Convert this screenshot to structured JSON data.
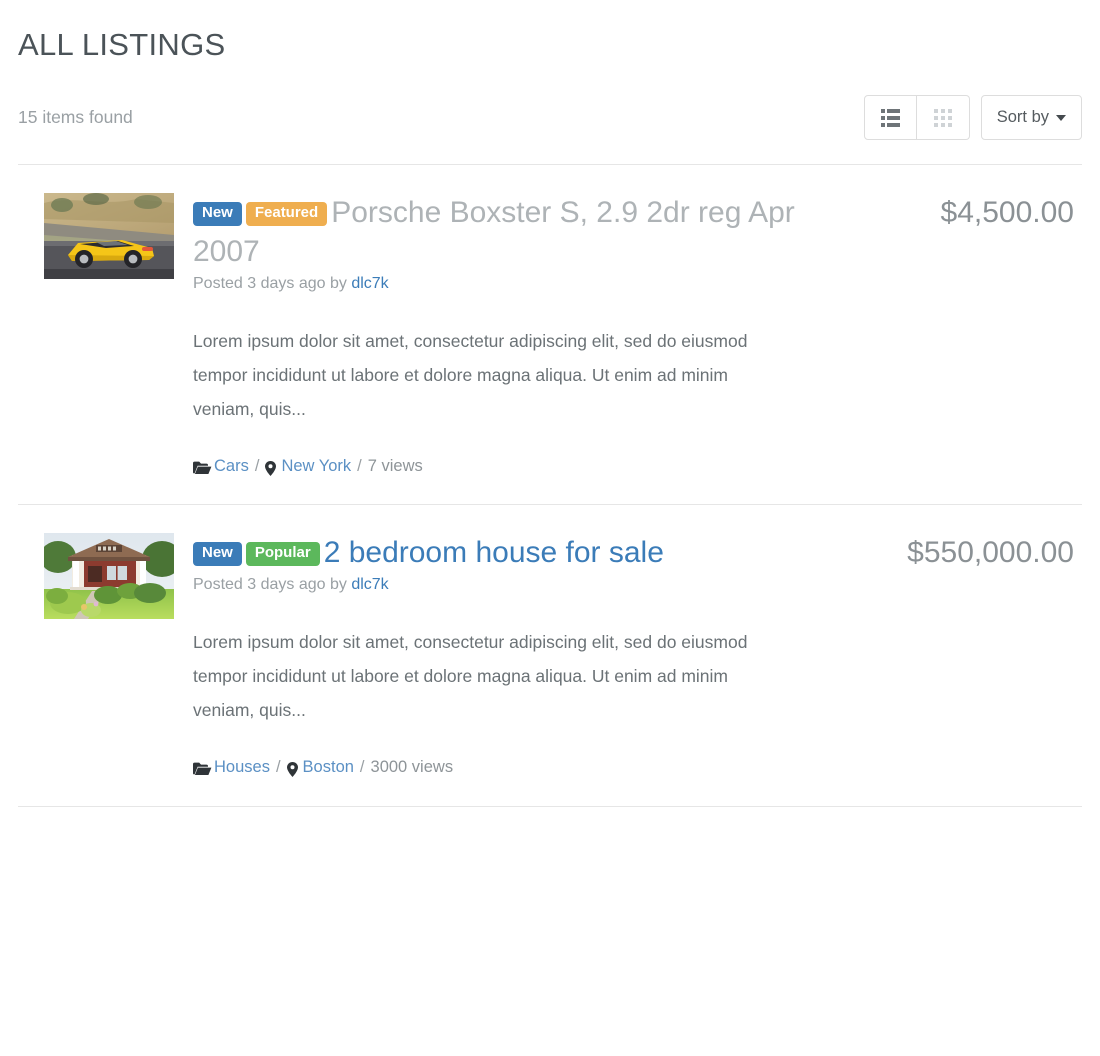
{
  "page": {
    "title": "ALL LISTINGS"
  },
  "toolbar": {
    "items_found": "15 items found",
    "list_view_label": "List view",
    "grid_view_label": "Grid view",
    "sort_label": "Sort by"
  },
  "colors": {
    "badge_new": "#3b7cb8",
    "badge_featured": "#efae4f",
    "badge_popular": "#5cb85c",
    "link": "#3b7cb8",
    "muted_title": "#aeb3b6",
    "price": "#8b9195",
    "divider": "#e6e6e6"
  },
  "listings": [
    {
      "badges": [
        {
          "label": "New",
          "color": "#3b7cb8"
        },
        {
          "label": "Featured",
          "color": "#efae4f"
        }
      ],
      "title": "Porsche Boxster S, 2.9 2dr reg Apr 2007",
      "title_style": "muted",
      "posted_prefix": "Posted 3 days ago by ",
      "author": "dlc7k",
      "excerpt": "Lorem ipsum dolor sit amet, consectetur adipiscing elit, sed do eiusmod tempor incididunt ut labore et dolore magna aliqua. Ut enim ad minim veniam, quis...",
      "category": "Cars",
      "location": "New York",
      "views": "7 views",
      "price": "$4,500.00",
      "thumb": "yellow-porsche-boxster",
      "separator": "/"
    },
    {
      "badges": [
        {
          "label": "New",
          "color": "#3b7cb8"
        },
        {
          "label": "Popular",
          "color": "#5cb85c"
        }
      ],
      "title": "2 bedroom house for sale",
      "title_style": "link",
      "posted_prefix": "Posted 3 days ago by ",
      "author": "dlc7k",
      "excerpt": "Lorem ipsum dolor sit amet, consectetur adipiscing elit, sed do eiusmod tempor incididunt ut labore et dolore magna aliqua. Ut enim ad minim veniam, quis...",
      "category": "Houses",
      "location": "Boston",
      "views": "3000 views",
      "price": "$550,000.00",
      "thumb": "house-with-lawn",
      "separator": "/"
    }
  ]
}
